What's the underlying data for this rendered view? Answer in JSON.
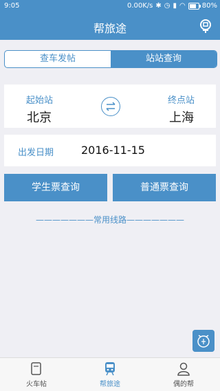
{
  "status": {
    "time": "9:05",
    "network": "0.00K/s",
    "battery": "80%"
  },
  "header": {
    "title": "帮旅途"
  },
  "segment": {
    "tab1": "查车发帖",
    "tab2": "站站查询"
  },
  "stations": {
    "from_label": "起始站",
    "from_value": "北京",
    "to_label": "终点站",
    "to_value": "上海"
  },
  "date": {
    "label": "出发日期",
    "value": "2016-11-15"
  },
  "buttons": {
    "student": "学生票查询",
    "normal": "普通票查询"
  },
  "common_lines": "———————常用线路———————",
  "tabs": [
    {
      "label": "火车帖",
      "icon": "document-icon"
    },
    {
      "label": "帮旅途",
      "icon": "train-icon"
    },
    {
      "label": "偶的帮",
      "icon": "person-icon"
    }
  ],
  "colors": {
    "accent": "#4a90c8",
    "background": "#efeff4"
  }
}
